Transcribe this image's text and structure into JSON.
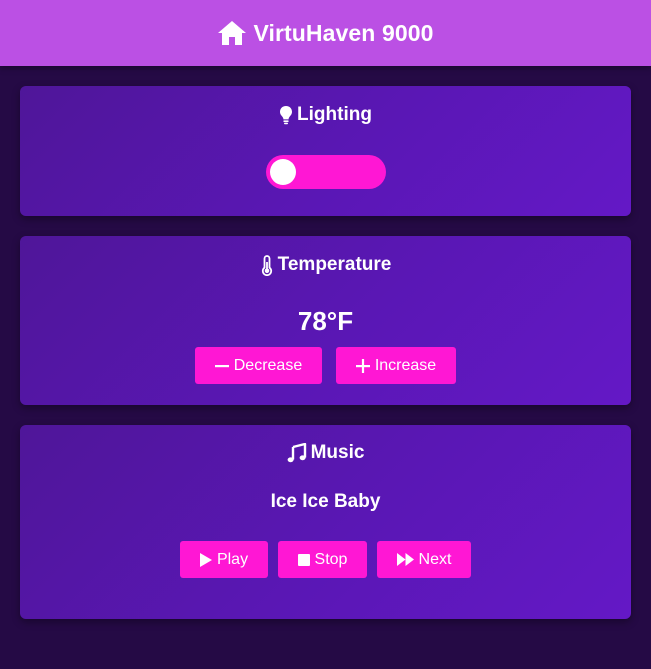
{
  "header": {
    "title": "VirtuHaven 9000",
    "icon": "home-icon"
  },
  "lighting": {
    "title": "Lighting",
    "icon": "lightbulb-icon",
    "toggle_on": false
  },
  "temperature": {
    "title": "Temperature",
    "icon": "thermometer-icon",
    "value": "78°F",
    "decrease_label": "Decrease",
    "increase_label": "Increase"
  },
  "music": {
    "title": "Music",
    "icon": "music-note-icon",
    "song": "Ice Ice Baby",
    "play_label": "Play",
    "stop_label": "Stop",
    "next_label": "Next"
  },
  "colors": {
    "header": "#bb50e4",
    "background": "#250a45",
    "card": "#5a17b5",
    "accent": "#ff17d4",
    "text": "#ffffff"
  }
}
